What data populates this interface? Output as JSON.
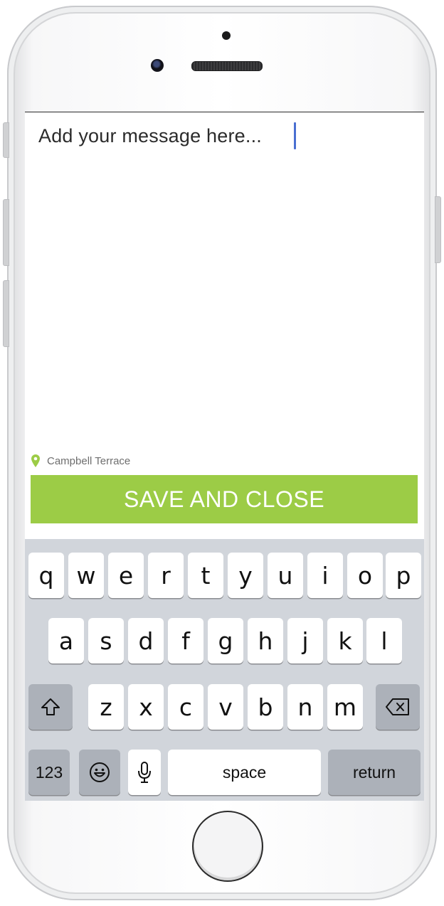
{
  "message": {
    "text": "Add your message here..."
  },
  "location": {
    "label": "Campbell Terrace",
    "pin_color": "#9ccc46"
  },
  "save_button": {
    "label": "SAVE AND CLOSE",
    "color": "#9ccc46"
  },
  "keyboard": {
    "row1": [
      "q",
      "w",
      "e",
      "r",
      "t",
      "y",
      "u",
      "i",
      "o",
      "p"
    ],
    "row2": [
      "a",
      "s",
      "d",
      "f",
      "g",
      "h",
      "j",
      "k",
      "l"
    ],
    "row3": [
      "z",
      "x",
      "c",
      "v",
      "b",
      "n",
      "m"
    ],
    "numbers_label": "123",
    "space_label": "space",
    "return_label": "return",
    "shift_icon": "shift-arrow-icon",
    "backspace_icon": "backspace-icon",
    "emoji_icon": "emoji-icon",
    "mic_icon": "microphone-icon"
  }
}
